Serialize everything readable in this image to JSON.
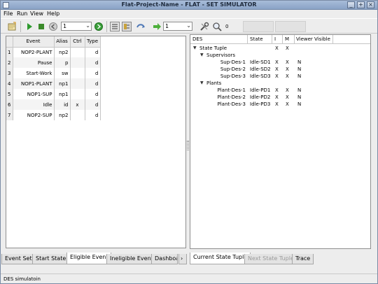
{
  "window": {
    "title": "Flat-Project-Name - FLAT - SET SIMULATOR",
    "controls": {
      "minimize": "_",
      "maximize": "+",
      "close": "×"
    }
  },
  "menu": {
    "file": "File",
    "run": "Run",
    "view": "View",
    "help": "Help"
  },
  "toolbar": {
    "step_combo_value": "1",
    "step_combo_value_2": "1",
    "counter_value": "0"
  },
  "event_table": {
    "columns": [
      "Event",
      "Alias",
      "Ctrl",
      "Type"
    ],
    "rows": [
      {
        "num": "1",
        "event": "NOP2-PLANT",
        "alias": "np2",
        "ctrl": "",
        "type": "d"
      },
      {
        "num": "2",
        "event": "Pause",
        "alias": "p",
        "ctrl": "",
        "type": "d"
      },
      {
        "num": "3",
        "event": "Start-Work",
        "alias": "sw",
        "ctrl": "",
        "type": "d"
      },
      {
        "num": "4",
        "event": "NOP1-PLANT",
        "alias": "np1",
        "ctrl": "",
        "type": "d"
      },
      {
        "num": "5",
        "event": "NOP1-SUP",
        "alias": "np1",
        "ctrl": "",
        "type": "d"
      },
      {
        "num": "6",
        "event": "Idle",
        "alias": "id",
        "ctrl": "x",
        "type": "d"
      },
      {
        "num": "7",
        "event": "NOP2-SUP",
        "alias": "np2",
        "ctrl": "",
        "type": "d"
      }
    ]
  },
  "des_table": {
    "columns": {
      "des": "DES",
      "state": "State",
      "i": "I",
      "m": "M",
      "viewer": "Viewer Visible"
    },
    "root": {
      "label": "State Tuple",
      "i": "X",
      "m": "X"
    },
    "groups": [
      {
        "label": "Supervisors",
        "rows": [
          {
            "des": "Sup-Des-1",
            "state": "Idle-SD1",
            "i": "X",
            "m": "X",
            "v": "N"
          },
          {
            "des": "Sup-Des-2",
            "state": "Idle-SD2",
            "i": "X",
            "m": "X",
            "v": "N"
          },
          {
            "des": "Sup-Des-3",
            "state": "Idle-SD3",
            "i": "X",
            "m": "X",
            "v": "N"
          }
        ]
      },
      {
        "label": "Plants",
        "rows": [
          {
            "des": "Plant-Des-1",
            "state": "Idle-PD1",
            "i": "X",
            "m": "X",
            "v": "N"
          },
          {
            "des": "Plant-Des-2",
            "state": "Idle-PD2",
            "i": "X",
            "m": "X",
            "v": "N"
          },
          {
            "des": "Plant-Des-3",
            "state": "Idle-PD3",
            "i": "X",
            "m": "X",
            "v": "N"
          }
        ]
      }
    ]
  },
  "left_tabs": [
    "Event Set",
    "Start State",
    "Eligible Event",
    "Ineligible Event",
    "Dashboa"
  ],
  "left_tab_active": "Eligible Event",
  "right_tabs": [
    "Current State Tuple",
    "Next State Tuple",
    "Trace"
  ],
  "right_tab_active": "Current State Tuple",
  "status": {
    "text": "DES simulatoin"
  },
  "colors": {
    "titlebar": "#8aa3c6",
    "run_green": "#2e9a2e",
    "stop_green": "#3a8a2a"
  }
}
